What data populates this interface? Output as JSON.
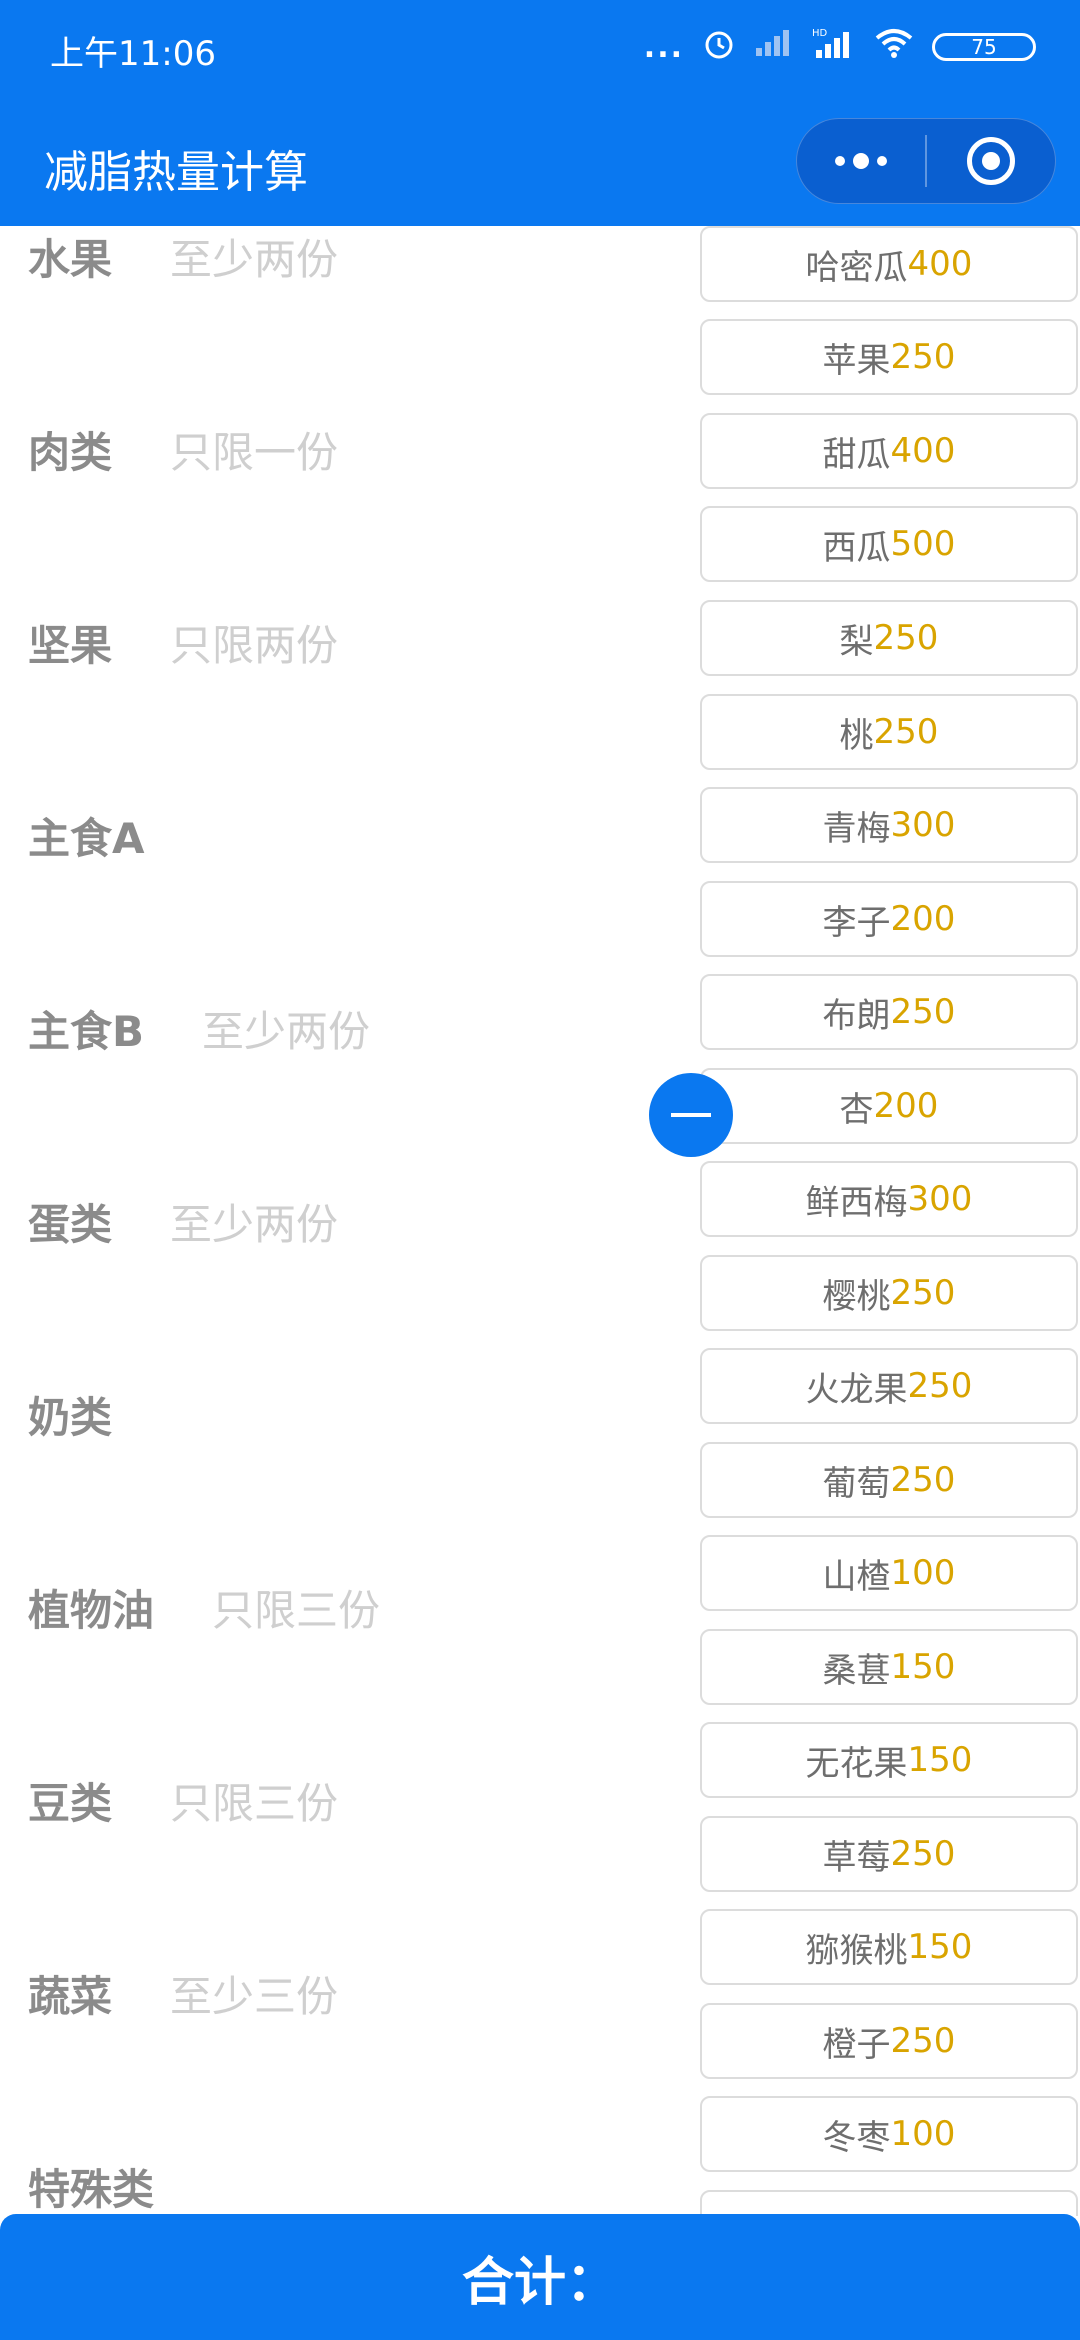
{
  "status_bar": {
    "time": "上午11:06",
    "battery": "75",
    "dots": "...",
    "hd": "HD"
  },
  "header": {
    "title": "减脂热量计算"
  },
  "categories": [
    {
      "name": "水果",
      "note": "至少两份"
    },
    {
      "name": "肉类",
      "note": "只限一份"
    },
    {
      "name": "坚果",
      "note": "只限两份"
    },
    {
      "name": "主食A",
      "note": ""
    },
    {
      "name": "主食B",
      "note": "至少两份"
    },
    {
      "name": "蛋类",
      "note": "至少两份"
    },
    {
      "name": "奶类",
      "note": ""
    },
    {
      "name": "植物油",
      "note": "只限三份"
    },
    {
      "name": "豆类",
      "note": "只限三份"
    },
    {
      "name": "蔬菜",
      "note": "至少三份"
    },
    {
      "name": "特殊类",
      "note": ""
    }
  ],
  "fruits": [
    {
      "name": "哈密瓜",
      "cal": "400"
    },
    {
      "name": "苹果",
      "cal": "250"
    },
    {
      "name": "甜瓜",
      "cal": "400"
    },
    {
      "name": "西瓜",
      "cal": "500"
    },
    {
      "name": "梨",
      "cal": "250"
    },
    {
      "name": "桃",
      "cal": "250"
    },
    {
      "name": "青梅",
      "cal": "300"
    },
    {
      "name": "李子",
      "cal": "200"
    },
    {
      "name": "布朗",
      "cal": "250"
    },
    {
      "name": "杏",
      "cal": "200"
    },
    {
      "name": "鲜西梅",
      "cal": "300"
    },
    {
      "name": "樱桃",
      "cal": "250"
    },
    {
      "name": "火龙果",
      "cal": "250"
    },
    {
      "name": "葡萄",
      "cal": "250"
    },
    {
      "name": "山楂",
      "cal": "100"
    },
    {
      "name": "桑葚",
      "cal": "150"
    },
    {
      "name": "无花果",
      "cal": "150"
    },
    {
      "name": "草莓",
      "cal": "250"
    },
    {
      "name": "猕猴桃",
      "cal": "150"
    },
    {
      "name": "橙子",
      "cal": "250"
    },
    {
      "name": "冬枣",
      "cal": "100"
    }
  ],
  "footer": {
    "total_label": "合计："
  },
  "colors": {
    "primary": "#0a78f0",
    "calorie": "#d9a400"
  }
}
